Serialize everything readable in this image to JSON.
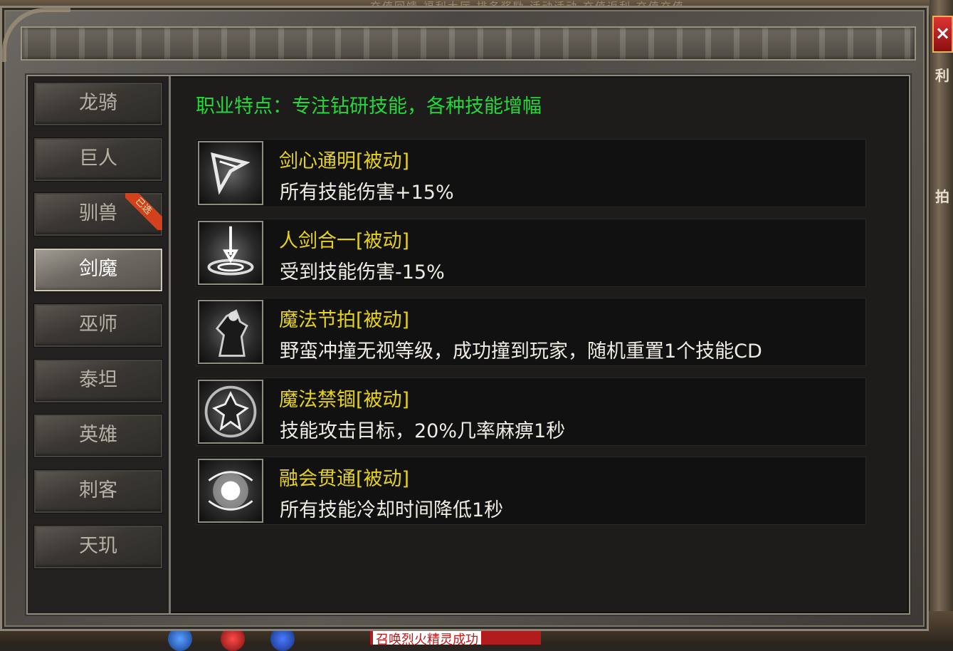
{
  "background": {
    "top_menu_text": "充值回馈  福利大厅  排名奖励  活动活动  充值返利  充值充值",
    "bottom_notice": "召唤烈火精灵成功"
  },
  "window": {
    "close_label": "×"
  },
  "classes": [
    {
      "label": "龙骑",
      "active": false
    },
    {
      "label": "巨人",
      "active": false
    },
    {
      "label": "驯兽",
      "active": false,
      "badge": "已选"
    },
    {
      "label": "剑魔",
      "active": true
    },
    {
      "label": "巫师",
      "active": false
    },
    {
      "label": "泰坦",
      "active": false
    },
    {
      "label": "英雄",
      "active": false
    },
    {
      "label": "刺客",
      "active": false
    },
    {
      "label": "天玑",
      "active": false
    }
  ],
  "trait": "职业特点：专注钻研技能，各种技能增幅",
  "skills": [
    {
      "name": "剑心通明[被动]",
      "desc": "所有技能伤害+15%",
      "icon": "blade-icon"
    },
    {
      "name": "人剑合一[被动]",
      "desc": "受到技能伤害-15%",
      "icon": "sword-impact-icon"
    },
    {
      "name": "魔法节拍[被动]",
      "desc": "野蛮冲撞无视等级，成功撞到玩家，随机重置1个技能CD",
      "icon": "warrior-charge-icon"
    },
    {
      "name": "魔法禁锢[被动]",
      "desc": "技能攻击目标，20%几率麻痹1秒",
      "icon": "bound-figure-icon"
    },
    {
      "name": "融会贯通[被动]",
      "desc": "所有技能冷却时间降低1秒",
      "icon": "glowing-orb-icon"
    }
  ],
  "colors": {
    "trait": "#22d83a",
    "skill_name": "#e6d21a",
    "badge": "#d2401c"
  }
}
